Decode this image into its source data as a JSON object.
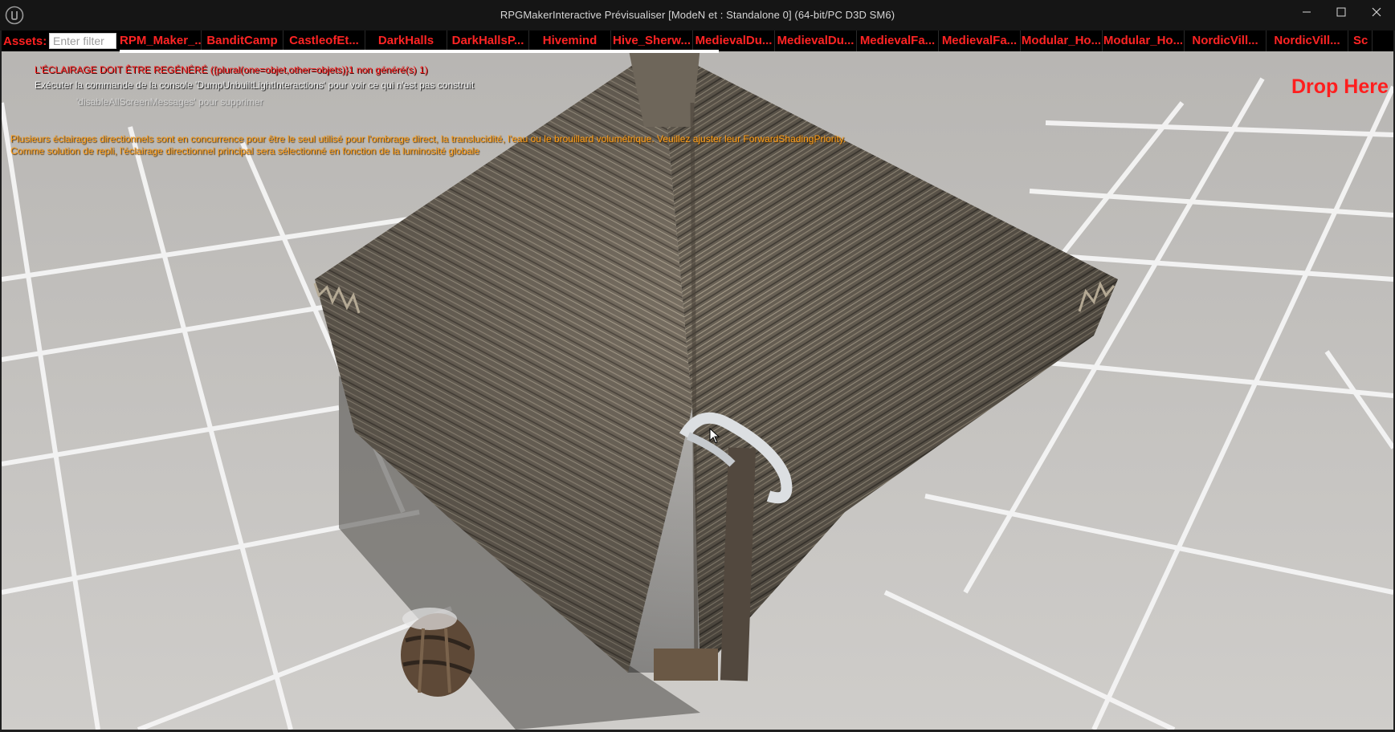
{
  "window": {
    "title": "RPGMakerInteractive Prévisualiser [ModeN et : Standalone 0]  (64-bit/PC D3D SM6)",
    "logo_icon": "unreal-engine-logo-icon",
    "controls": {
      "minimize_icon": "minimize-icon",
      "maximize_icon": "maximize-icon",
      "close_icon": "close-icon"
    }
  },
  "assets_bar": {
    "label": "Assets:",
    "filter_placeholder": "Enter filter",
    "items": [
      "RPM_Maker_...",
      "BanditCamp",
      "CastleofEt...",
      "DarkHalls",
      "DarkHallsP...",
      "Hivemind",
      "Hive_Sherw...",
      "MedievalDu...",
      "MedievalDu...",
      "MedievalFa...",
      "MedievalFa...",
      "Modular_Ho...",
      "Modular_Ho...",
      "NordicVill...",
      "NordicVill...",
      "Sc"
    ],
    "colors": {
      "text": "#ff2424",
      "background": "#000000"
    }
  },
  "messages": {
    "lighting_rebuild": "L'ÉCLAIRAGE DOIT ÊTRE REGÉNÉRÉ ({plural(one=objet,other=objets)}1 non généré(s) 1)",
    "dump_command": "Exécuter la commande de la console 'DumpUnbuiltLightInteractions' pour voir ce qui n'est pas construit",
    "disable_messages": "'disableAllScreenMessages' pour supprimer",
    "directional_line1": "Plusieurs éclairages directionnels sont en concurrence pour être le seul utilisé pour l'ombrage direct, la translucidité, l'eau ou le brouillard volumétrique. Veuillez ajuster leur ForwardShadingPriority.",
    "directional_line2": "Comme solution de repli, l'éclairage directionnel principal sera sélectionné en fonction de la luminosité globale"
  },
  "drop_zone": {
    "label": "Drop Here",
    "color": "#ff1e1e"
  },
  "scene": {
    "description_icons": [
      "thatched-roof",
      "mouse-cursor-icon"
    ],
    "colors": {
      "floor": "#bdbbb8",
      "grid_line": "#f4f4f4",
      "thatch": "#7d7467"
    }
  }
}
